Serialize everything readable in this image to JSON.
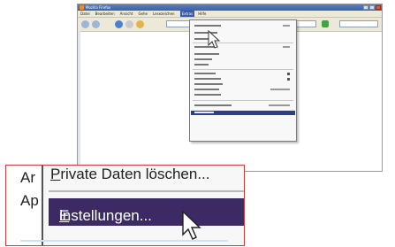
{
  "browser": {
    "title": "Mozilla Firefox",
    "menu": [
      "Datei",
      "Bearbeiten",
      "Ansicht",
      "Gehe",
      "Lesezeichen",
      "Extras",
      "Hilfe"
    ],
    "active_menu": "Extras"
  },
  "zoom": {
    "bg_lines": [
      "Ar",
      "Ap"
    ],
    "item_private_prefix": "P",
    "item_private_rest": "rivate Daten löschen...",
    "item_settings_prefix": "E",
    "item_settings_rest": "instellungen..."
  },
  "colors": {
    "highlight": "#3b2a63",
    "inset_border": "#d23a3a",
    "title_bar": "#3b62a8"
  }
}
